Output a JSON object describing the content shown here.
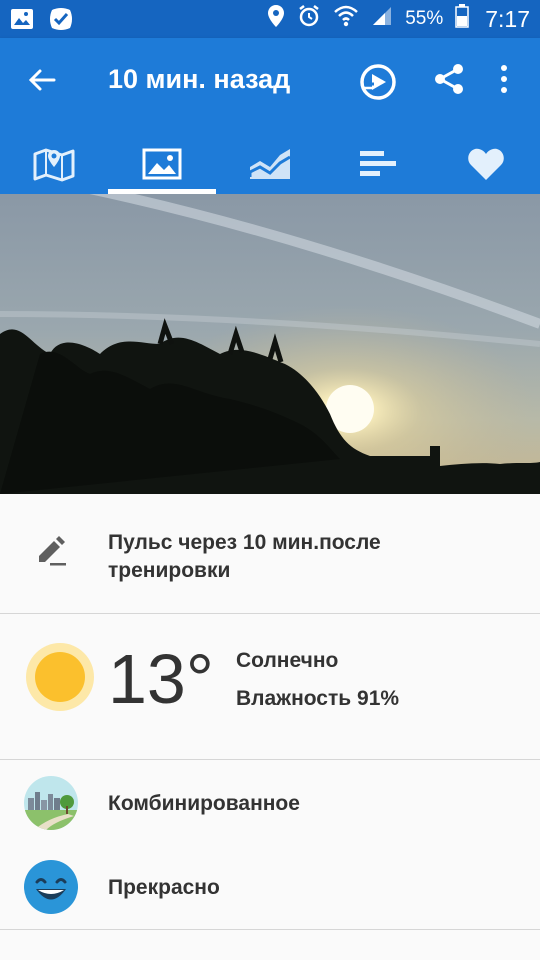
{
  "status_bar": {
    "battery_percent": "55%",
    "time": "7:17",
    "left_icons": [
      "gallery-icon",
      "checkmark-badge-icon"
    ],
    "right_icons": [
      "location-icon",
      "alarm-icon",
      "wifi-icon",
      "signal-icon",
      "battery-icon"
    ]
  },
  "app_bar": {
    "title": "10 мин. назад",
    "actions": [
      "share-route-icon",
      "share-icon",
      "more-vert-icon"
    ],
    "color": "#1e7bd8"
  },
  "tabs": [
    {
      "icon": "map-icon",
      "active": false
    },
    {
      "icon": "photo-icon",
      "active": true
    },
    {
      "icon": "chart-icon",
      "active": false
    },
    {
      "icon": "list-icon",
      "active": false
    },
    {
      "icon": "heart-icon",
      "active": false
    }
  ],
  "note": {
    "text": "Пульс через 10 мин.после тренировки"
  },
  "weather": {
    "temperature": "13°",
    "condition": "Солнечно",
    "humidity": "Влажность 91%"
  },
  "surface": {
    "label": "Комбинированное"
  },
  "feeling": {
    "label": "Прекрасно"
  }
}
